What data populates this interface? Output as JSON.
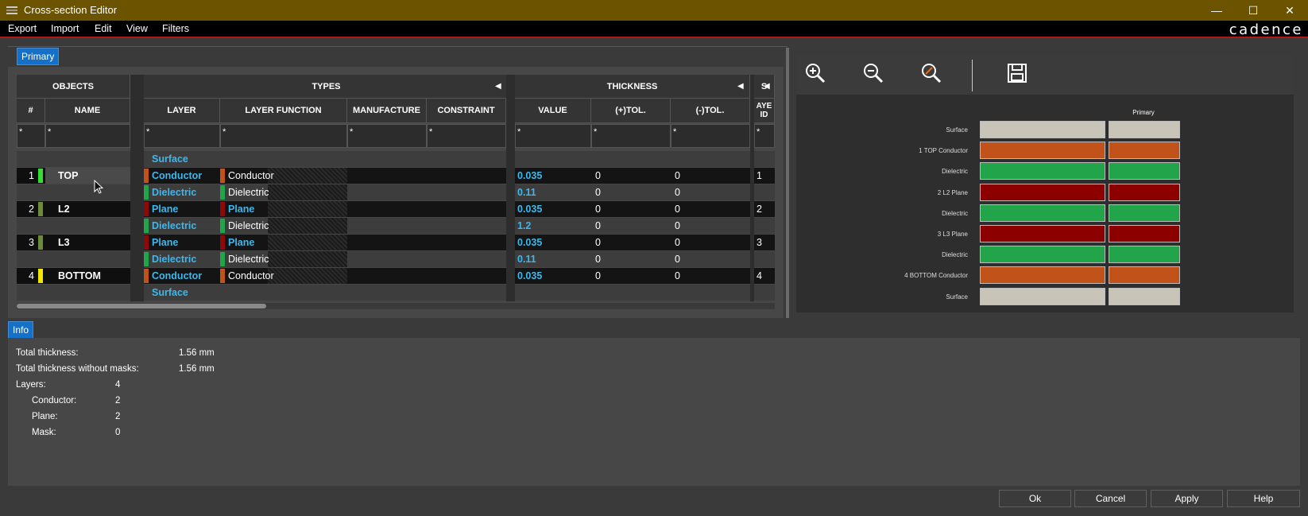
{
  "window": {
    "title": "Cross-section Editor",
    "minimize": "—",
    "maximize": "☐",
    "close": "✕"
  },
  "menu": [
    "Export",
    "Import",
    "Edit",
    "View",
    "Filters"
  ],
  "brand": "cadence",
  "tabs": {
    "primary": "Primary",
    "info": "Info"
  },
  "groups": {
    "objects": "OBJECTS",
    "types": "TYPES",
    "thickness": "THICKNESS",
    "s": "S"
  },
  "columns": {
    "num": "#",
    "name": "NAME",
    "layer": "LAYER",
    "layer_function": "LAYER FUNCTION",
    "manufacture": "MANUFACTURE",
    "constraint": "CONSTRAINT",
    "value": "VALUE",
    "plus_tol": "(+)TOL.",
    "minus_tol": "(-)TOL.",
    "layer_id_1": "AYE",
    "layer_id_2": "ID"
  },
  "filter": "*",
  "rows": [
    {
      "num": "",
      "name": "",
      "layer": "Surface",
      "func": "",
      "value": "",
      "ptol": "",
      "mtol": "",
      "id": "",
      "color": ""
    },
    {
      "num": "1",
      "name": "TOP",
      "layer": "Conductor",
      "func": "Conductor",
      "value": "0.035",
      "ptol": "0",
      "mtol": "0",
      "id": "1",
      "color": "#c0521a"
    },
    {
      "num": "",
      "name": "",
      "layer": "Dielectric",
      "func": "Dielectric",
      "value": "0.11",
      "ptol": "0",
      "mtol": "0",
      "id": "",
      "color": "#22a44a"
    },
    {
      "num": "2",
      "name": "L2",
      "layer": "Plane",
      "func": "Plane",
      "value": "0.035",
      "ptol": "0",
      "mtol": "0",
      "id": "2",
      "color": "#8c0a0a"
    },
    {
      "num": "",
      "name": "",
      "layer": "Dielectric",
      "func": "Dielectric",
      "value": "1.2",
      "ptol": "0",
      "mtol": "0",
      "id": "",
      "color": "#22a44a"
    },
    {
      "num": "3",
      "name": "L3",
      "layer": "Plane",
      "func": "Plane",
      "value": "0.035",
      "ptol": "0",
      "mtol": "0",
      "id": "3",
      "color": "#8c0a0a"
    },
    {
      "num": "",
      "name": "",
      "layer": "Dielectric",
      "func": "Dielectric",
      "value": "0.11",
      "ptol": "0",
      "mtol": "0",
      "id": "",
      "color": "#22a44a"
    },
    {
      "num": "4",
      "name": "BOTTOM",
      "layer": "Conductor",
      "func": "Conductor",
      "value": "0.035",
      "ptol": "0",
      "mtol": "0",
      "id": "4",
      "color": "#c0521a"
    },
    {
      "num": "",
      "name": "",
      "layer": "Surface",
      "func": "",
      "value": "",
      "ptol": "",
      "mtol": "",
      "id": "",
      "color": ""
    }
  ],
  "name_swatch_colors": [
    "#33dd33",
    "#6b8b3a",
    "#6b8b3a",
    "#f2e600"
  ],
  "preview": {
    "column_title": "Primary",
    "labels": [
      "Surface",
      "1    TOP Conductor",
      "Dielectric",
      "2    L2 Plane",
      "Dielectric",
      "3    L3 Plane",
      "Dielectric",
      "4    BOTTOM Conductor",
      "Surface"
    ],
    "colors": [
      "#c8c5b8",
      "#c0521a",
      "#22a44a",
      "#8c0000",
      "#22a44a",
      "#8c0000",
      "#22a44a",
      "#c0521a",
      "#c8c5b8"
    ]
  },
  "info": {
    "total_thickness_label": "Total thickness:",
    "total_thickness": "1.56 mm",
    "total_wo_masks_label": "Total thickness without masks:",
    "total_wo_masks": "1.56 mm",
    "layers_label": "Layers:",
    "layers": "4",
    "conductor_label": "Conductor:",
    "conductor": "2",
    "plane_label": "Plane:",
    "plane": "2",
    "mask_label": "Mask:",
    "mask": "0"
  },
  "buttons": {
    "ok": "Ok",
    "cancel": "Cancel",
    "apply": "Apply",
    "help": "Help"
  }
}
